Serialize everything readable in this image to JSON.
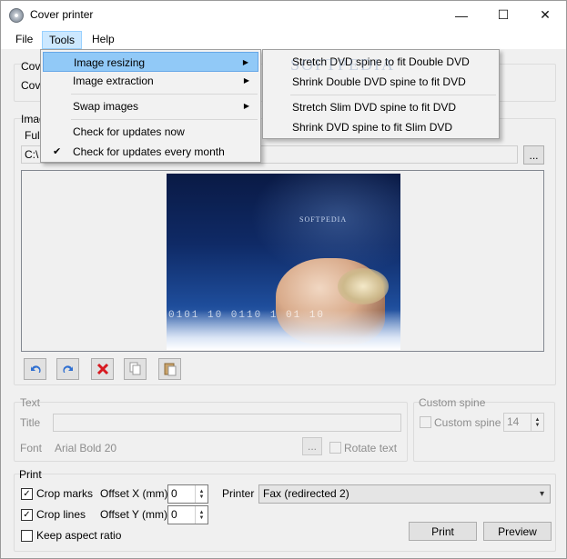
{
  "window": {
    "title": "Cover printer",
    "app_icon": "disc-icon"
  },
  "window_controls": {
    "minimize": "—",
    "maximize": "☐",
    "close": "✕"
  },
  "menubar": {
    "file": "File",
    "tools": "Tools",
    "help": "Help"
  },
  "tools_menu": {
    "items": [
      {
        "label": "Image resizing",
        "submenu": true,
        "highlighted": true
      },
      {
        "label": "Image extraction",
        "submenu": true
      },
      {
        "label": "Swap images",
        "submenu": true
      },
      {
        "label": "Check for updates now"
      },
      {
        "label": "Check for updates every month",
        "checked": true
      }
    ]
  },
  "resize_submenu": {
    "items": [
      "Stretch DVD spine to fit Double DVD",
      "Shrink Double DVD spine to fit DVD",
      "Stretch Slim DVD spine to fit DVD",
      "Shrink DVD spine to fit Slim DVD"
    ]
  },
  "watermark": "SOFTPEDIA",
  "cover_group": {
    "label": "Cove",
    "row1": "Cove"
  },
  "image_group": {
    "label": "Imag",
    "mode": "Full",
    "path": "C:\\",
    "browse": "...",
    "preview_text": "SOFTPEDIA",
    "preview_digits": "0101 10 0110 1 01 10"
  },
  "toolbar": {
    "undo": "undo-icon",
    "redo": "redo-icon",
    "delete": "delete-icon",
    "copy": "copy-icon",
    "paste": "paste-icon"
  },
  "text_group": {
    "label": "Text",
    "title_label": "Title",
    "title_value": "",
    "font_label": "Font",
    "font_value": "Arial Bold 20",
    "font_button": "...",
    "rotate_label": "Rotate text",
    "rotate_checked": false
  },
  "custom_spine": {
    "label": "Custom spine",
    "check_label": "Custom spine",
    "checked": false,
    "value": "14"
  },
  "print_group": {
    "label": "Print",
    "crop_marks": "Crop marks",
    "crop_marks_checked": true,
    "crop_lines": "Crop lines",
    "crop_lines_checked": true,
    "keep_aspect": "Keep aspect ratio",
    "keep_aspect_checked": false,
    "offset_x_label": "Offset X (mm)",
    "offset_x": "0",
    "offset_y_label": "Offset Y (mm)",
    "offset_y": "0",
    "printer_label": "Printer",
    "printer_value": "Fax (redirected 2)",
    "print_button": "Print",
    "preview_button": "Preview"
  },
  "colors": {
    "menu_highlight": "#91c9f7",
    "menubar_selected": "#cce8ff",
    "window_bg": "#f0f0f0"
  }
}
